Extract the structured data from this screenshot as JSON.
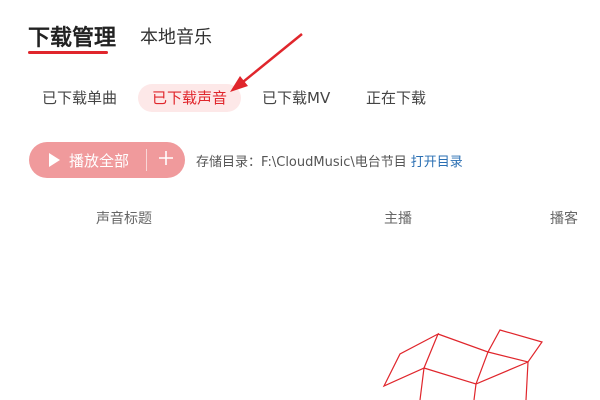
{
  "main_tabs": [
    {
      "label": "下载管理",
      "active": true
    },
    {
      "label": "本地音乐",
      "active": false
    }
  ],
  "sub_tabs": [
    {
      "label": "已下载单曲",
      "active": false
    },
    {
      "label": "已下载声音",
      "active": true
    },
    {
      "label": "已下载MV",
      "active": false
    },
    {
      "label": "正在下载",
      "active": false
    }
  ],
  "toolbar": {
    "play_all_label": "播放全部",
    "add_icon": "plus-icon",
    "play_icon": "play-icon",
    "storage_label": "存储目录：",
    "storage_path": "F:\\CloudMusic\\电台节目",
    "open_dir_label": "打开目录"
  },
  "table": {
    "columns": [
      "声音标题",
      "主播",
      "播客"
    ]
  },
  "colors": {
    "accent": "#e0262c",
    "play_button": "#f09a9c",
    "active_tab_bg": "#fde8e8",
    "link": "#2a6fb3"
  }
}
